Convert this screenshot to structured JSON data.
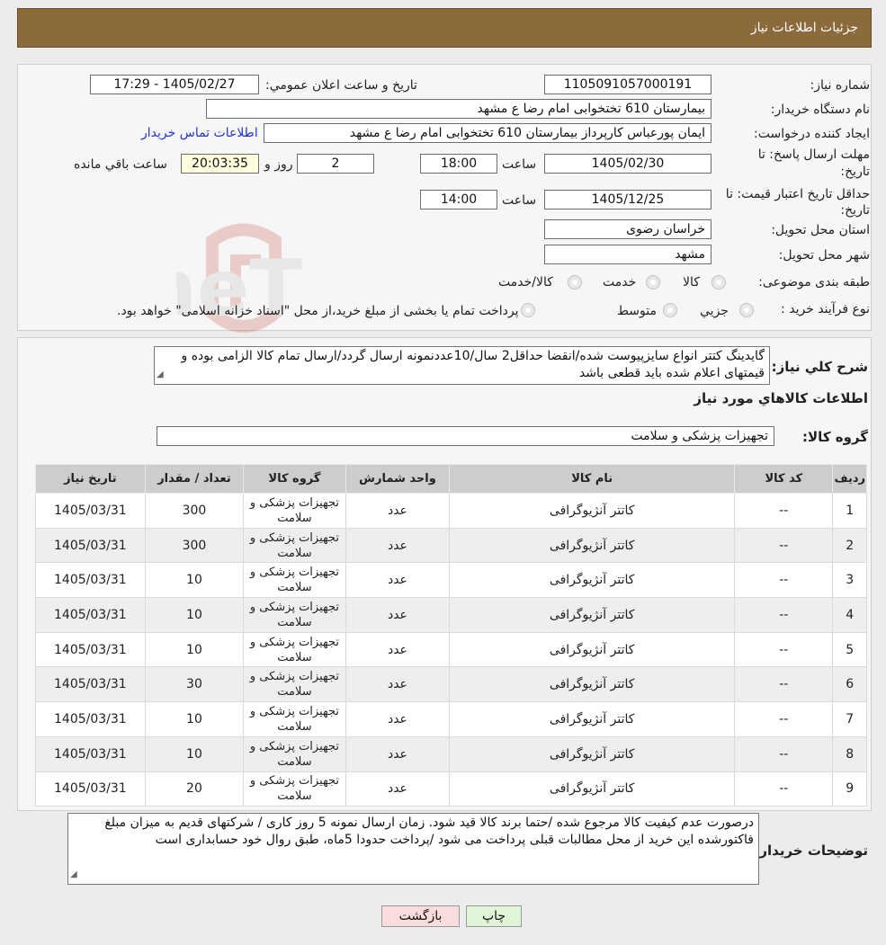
{
  "header": {
    "title": "جزئیات اطلاعات نیاز"
  },
  "watermark": {
    "text": "AriaTender.neT"
  },
  "fields": {
    "need_number_label": "شماره نیاز:",
    "need_number": "1105091057000191",
    "announce_label": "تاریخ و ساعت اعلان عمومي:",
    "announce_value": "1405/02/27 - 17:29",
    "buyer_org_label": "نام دستگاه خریدار:",
    "buyer_org": "بیمارستان 610 تختخوابی امام رضا ع  مشهد",
    "creator_label": "ایجاد کننده درخواست:",
    "creator": "ایمان پورعباس کارپرداز بیمارستان 610 تختخوابی امام رضا ع  مشهد",
    "contact_link": "اطلاعات تماس خریدار",
    "deadline_label_1": "مهلت ارسال پاسخ: تا",
    "deadline_label_2": "تاریخ:",
    "deadline_date": "1405/02/30",
    "time_word": "ساعت",
    "deadline_time": "18:00",
    "days": "2",
    "days_word": "روز و",
    "remaining_time": "20:03:35",
    "remaining_word": "ساعت باقي مانده",
    "validity_label_1": "حداقل تاریخ اعتبار قیمت: تا",
    "validity_label_2": "تاریخ:",
    "validity_date": "1405/12/25",
    "validity_time": "14:00",
    "province_label": "استان محل تحویل:",
    "province": "خراسان رضوی",
    "city_label": "شهر محل تحویل:",
    "city": "مشهد",
    "category_label": "طبقه بندی موضوعی:",
    "category_options": [
      "کالا",
      "خدمت",
      "کالا/خدمت"
    ],
    "process_label": "نوع فرآیند خرید :",
    "process_options": [
      "جزیي",
      "متوسط"
    ],
    "process_note": "پرداخت تمام یا بخشی از مبلغ خرید،از محل \"اسناد خزانه اسلامی\" خواهد بود."
  },
  "description": {
    "label": "شرح کلي نیاز:",
    "text": "گایدینگ کتتر انواع سایزپیوست شده/انقضا حداقل2 سال/10عددنمونه ارسال گردد/ارسال تمام کالا الزامی بوده و قیمتهای اعلام شده باید قطعی باشد"
  },
  "items_section": {
    "title": "اطلاعات کالاهاي مورد نیاز",
    "group_label": "گروه کالا:",
    "group_value": "تجهیزات پزشکی و سلامت"
  },
  "table": {
    "headers": [
      "ردیف",
      "کد کالا",
      "نام کالا",
      "واحد شمارش",
      "گروه کالا",
      "تعداد / مقدار",
      "تاریخ نیاز"
    ],
    "rows": [
      {
        "row": "1",
        "code": "--",
        "name": "کاتتر آنژیوگرافی",
        "unit": "عدد",
        "group": "تجهیزات پزشکی و سلامت",
        "qty": "300",
        "date": "1405/03/31"
      },
      {
        "row": "2",
        "code": "--",
        "name": "کاتتر آنژیوگرافی",
        "unit": "عدد",
        "group": "تجهیزات پزشکی و سلامت",
        "qty": "300",
        "date": "1405/03/31"
      },
      {
        "row": "3",
        "code": "--",
        "name": "کاتتر آنژیوگرافی",
        "unit": "عدد",
        "group": "تجهیزات پزشکی و سلامت",
        "qty": "10",
        "date": "1405/03/31"
      },
      {
        "row": "4",
        "code": "--",
        "name": "کاتتر آنژیوگرافی",
        "unit": "عدد",
        "group": "تجهیزات پزشکی و سلامت",
        "qty": "10",
        "date": "1405/03/31"
      },
      {
        "row": "5",
        "code": "--",
        "name": "کاتتر آنژیوگرافی",
        "unit": "عدد",
        "group": "تجهیزات پزشکی و سلامت",
        "qty": "10",
        "date": "1405/03/31"
      },
      {
        "row": "6",
        "code": "--",
        "name": "کاتتر آنژیوگرافی",
        "unit": "عدد",
        "group": "تجهیزات پزشکی و سلامت",
        "qty": "30",
        "date": "1405/03/31"
      },
      {
        "row": "7",
        "code": "--",
        "name": "کاتتر آنژیوگرافی",
        "unit": "عدد",
        "group": "تجهیزات پزشکی و سلامت",
        "qty": "10",
        "date": "1405/03/31"
      },
      {
        "row": "8",
        "code": "--",
        "name": "کاتتر آنژیوگرافی",
        "unit": "عدد",
        "group": "تجهیزات پزشکی و سلامت",
        "qty": "10",
        "date": "1405/03/31"
      },
      {
        "row": "9",
        "code": "--",
        "name": "کاتتر آنژیوگرافی",
        "unit": "عدد",
        "group": "تجهیزات پزشکی و سلامت",
        "qty": "20",
        "date": "1405/03/31"
      }
    ]
  },
  "buyer_notes": {
    "label": "توضیحات خریدار:",
    "text": "درصورت عدم کیفیت کالا مرجوع شده /حتما برند کالا قید شود. زمان ارسال نمونه 5 روز کاری /  شرکتهای قدیم به میزان مبلغ فاکتورشده این خرید از محل مطالبات قبلی پرداخت می شود /پرداخت حدودا 5ماه، طبق روال خود حسابداری است"
  },
  "buttons": {
    "print": "چاپ",
    "back": "بازگشت"
  },
  "colors": {
    "header": "#8b6a3b",
    "print_button": "#dff5d8",
    "back_button": "#fbdcdc",
    "link": "#2233cc"
  }
}
